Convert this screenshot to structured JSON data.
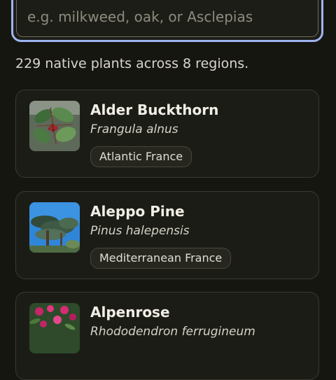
{
  "search": {
    "placeholder": "e.g. milkweed, oak, or Asclepias",
    "value": ""
  },
  "summary": "229 native plants across 8 regions.",
  "plants": [
    {
      "common": "Alder Buckthorn",
      "scientific": "Frangula alnus",
      "region": "Atlantic France",
      "image": "buckthorn-leaves-berries"
    },
    {
      "common": "Aleppo Pine",
      "scientific": "Pinus halepensis",
      "region": "Mediterranean France",
      "image": "pine-tree-blue-sky"
    },
    {
      "common": "Alpenrose",
      "scientific": "Rhododendron ferrugineum",
      "region": "",
      "image": "pink-flowers"
    }
  ],
  "colors": {
    "background": "#161611",
    "card": "#1c1c17",
    "focus_ring": "#9fb4f0"
  }
}
